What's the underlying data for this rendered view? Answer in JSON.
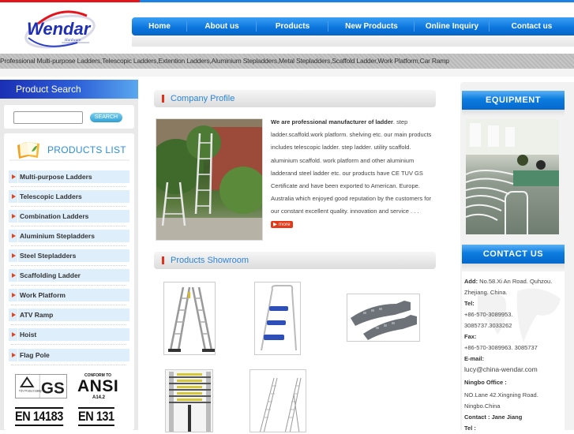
{
  "brand": {
    "logo_text": "Wendar",
    "logo_sub": "Hardware",
    "accent": "#1a82e2",
    "red": "#e3141b"
  },
  "nav": [
    "Home",
    "About us",
    "Products",
    "New Products",
    "Online Inquiry",
    "Contact us"
  ],
  "tagline": "Professional Multi-purpose Ladders,Telescopic Ladders,Extention Ladders,Aluminium Stepladders,Metal Stepladders,Scaffold Ladder,Work Platform,Car Ramp",
  "search": {
    "header": "Product Search",
    "placeholder": "",
    "button": "SEARCH"
  },
  "products_list": {
    "title": "PRODUCTS LIST",
    "items": [
      "Multi-purpose Ladders",
      "Telescopic Ladders",
      "Combination Ladders",
      "Aluminium Stepladders",
      "Steel Stepladders",
      "Scaffolding Ladder",
      "Work Platform",
      "ATV Ramp",
      "Hoist",
      "Flag Pole"
    ]
  },
  "certs": {
    "tuv": "TÜV Rheinland Product Safety",
    "gs": "GS",
    "ansi_top": "CONFORM TO",
    "ansi": "ANSI",
    "ansi_sub": "A14.2",
    "en1": "EN 14183",
    "en2": "EN 131"
  },
  "company_profile": {
    "title": "Company Profile",
    "lead": "We are professional manufacturer of ladder",
    "body": ". step ladder.scaffold.work platform. shelving etc. our main products includes telescopic ladder. step ladder. utility scaffold. aluminium scaffold. work platform and other aluminium ladderand steel ladder etc. our products have CE TUV GS Certificate and have been exported to American. Europe. Australia which enjoyed good reputation by the customers for our constant excellent quality. innovation and service . . . ",
    "more": "▶ more"
  },
  "showroom": {
    "title": "Products Showroom",
    "products": [
      "multi-purpose ladder",
      "steel stepladder",
      "car ramp",
      "telescopic ladder",
      "extension ladder"
    ]
  },
  "equipment": {
    "title": "EQUIPMENT"
  },
  "contact": {
    "title": "CONTACT US",
    "add_label": "Add:",
    "add": " No.58.Xi An Road. Quhzou.",
    "add2": "Zhejiang. China.",
    "tel_label": "Tel:",
    "tel1": "+86-570-3089953.",
    "tel2": "3085737.3033262",
    "fax_label": "Fax:",
    "fax": "+86-570-3089963. 3085737",
    "email_label": "E-mail:",
    "email": "lucy@china-wendar.com",
    "office_label": "Ningbo Office :",
    "office1": "NO.Lane 42.Xingning Road.",
    "office2": "Ningbo.China",
    "contact_person": "Contact : Jane Jiang",
    "tel3_label": "Tel :"
  }
}
